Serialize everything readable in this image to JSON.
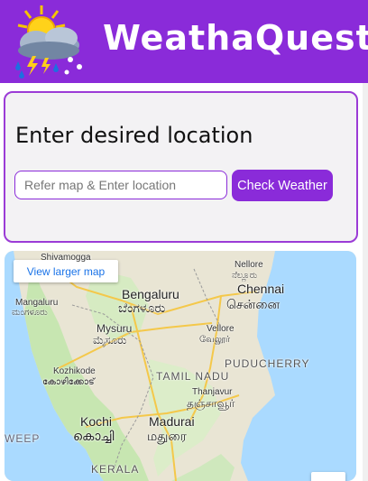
{
  "app": {
    "title": "WeathaQuest",
    "logo_icon": "weather-storm-sun-icon"
  },
  "search": {
    "heading": "Enter desired location",
    "placeholder": "Refer map & Enter location",
    "value": "",
    "button_label": "Check Weather"
  },
  "map": {
    "larger_map_link": "View larger map",
    "labels": {
      "shivamogga": "Shivamogga",
      "nellore": "Nellore",
      "nellore_local": "ನೆಲ್ಲೂರು",
      "bengaluru": "Bengaluru",
      "bengaluru_local": "ಬೆಂಗಳೂರು",
      "chennai": "Chennai",
      "chennai_local": "சென்னை",
      "mangaluru": "Mangaluru",
      "mangaluru_local": "ಮಂಗಳೂರು",
      "mysuru": "Mysuru",
      "mysuru_local": "ಮೈಸೂರು",
      "vellore": "Vellore",
      "vellore_local": "வேலூர்",
      "kozhikode": "Kozhikode",
      "kozhikode_local": "കോഴിക്കോട്",
      "tamil_nadu": "TAMIL NADU",
      "puducherry": "PUDUCHERRY",
      "thanjavur": "Thanjavur",
      "thanjavur_local": "தஞ்சாவூர்",
      "kochi": "Kochi",
      "kochi_local": "കൊച്ചി",
      "madurai": "Madurai",
      "madurai_local": "மதுரை",
      "weep": "WEEP",
      "kerala": "KERALA"
    }
  },
  "colors": {
    "brand": "#8a2bd9",
    "card_border": "#9b3bd6",
    "card_bg": "#f3f2f4"
  }
}
